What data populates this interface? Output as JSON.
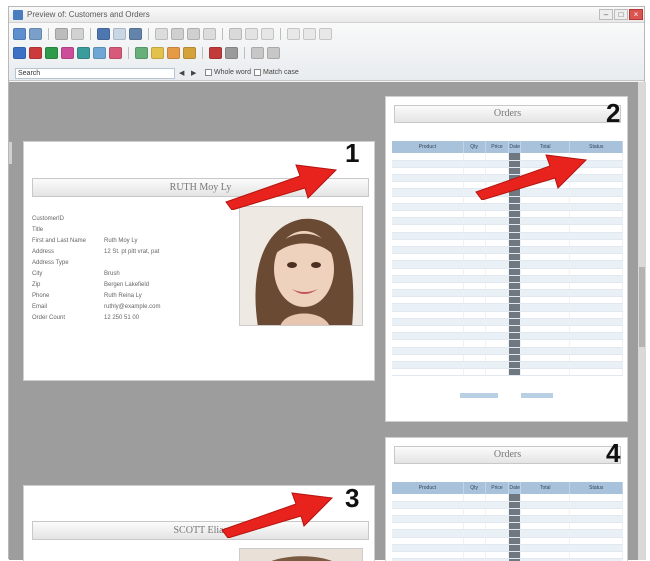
{
  "window": {
    "title": "Preview of: Customers and Orders"
  },
  "toolbar": {
    "search_label": "Search",
    "whole_word_label": "Whole word",
    "match_case_label": "Match case"
  },
  "customer_pages": [
    {
      "customer_name": "RUTH Moy Ly",
      "fields": [
        {
          "label": "CustomerID",
          "value": ""
        },
        {
          "label": "Title",
          "value": ""
        },
        {
          "label": "First and Last Name",
          "value": "Ruth Moy Ly"
        },
        {
          "label": "Address",
          "value": "12 St. pt pitt vrat, pat"
        },
        {
          "label": "Address Type",
          "value": ""
        },
        {
          "label": "City",
          "value": "Brush"
        },
        {
          "label": "Zip",
          "value": "Bergen Lakefield"
        },
        {
          "label": "Phone",
          "value": "Ruth Reina Ly"
        },
        {
          "label": "Email",
          "value": "ruthly@example.com"
        },
        {
          "label": "Order Count",
          "value": "12 250 51 00"
        }
      ]
    },
    {
      "customer_name": "SCOTT Elias",
      "fields": []
    }
  ],
  "orders_pages": [
    {
      "title": "Orders",
      "row_count": 31
    },
    {
      "title": "Orders",
      "row_count": 11
    }
  ],
  "orders_columns": [
    "Product",
    "Qty",
    "Price",
    "Date",
    "Total",
    "Status"
  ],
  "callouts": {
    "one": "1",
    "two": "2",
    "three": "3",
    "four": "4"
  },
  "colors": {
    "arrow": "#e8221c",
    "canvas": "#9d9d9d",
    "table_header": "#a8c2dc"
  }
}
